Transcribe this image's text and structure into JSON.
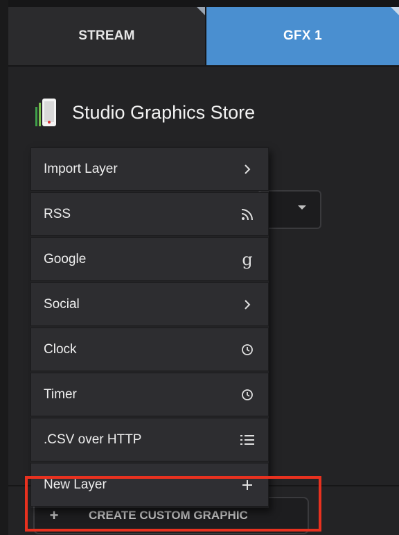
{
  "tabs": [
    {
      "label": "STREAM",
      "active": false
    },
    {
      "label": "GFX 1",
      "active": true
    }
  ],
  "store": {
    "title": "Studio Graphics Store"
  },
  "menu": {
    "items": [
      {
        "label": "Import Layer",
        "icon": "chevron-right-icon"
      },
      {
        "label": "RSS",
        "icon": "rss-icon"
      },
      {
        "label": "Google",
        "icon": "google-g-icon"
      },
      {
        "label": "Social",
        "icon": "chevron-right-icon"
      },
      {
        "label": "Clock",
        "icon": "clock-icon"
      },
      {
        "label": "Timer",
        "icon": "clock-icon"
      },
      {
        "label": ".CSV over HTTP",
        "icon": "list-icon"
      },
      {
        "label": "New Layer",
        "icon": "plus-icon"
      }
    ]
  },
  "create_button": {
    "plus": "+",
    "label": "CREATE CUSTOM GRAPHIC"
  },
  "colors": {
    "active_tab": "#4a8fd0",
    "highlight": "#e8311f"
  }
}
